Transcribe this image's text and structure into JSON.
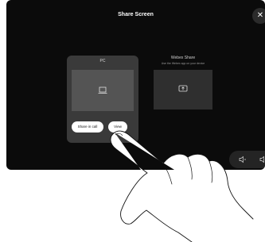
{
  "header": {
    "title": "Share Screen",
    "close_icon": "close-icon"
  },
  "pc": {
    "label": "PC",
    "preview_icon": "laptop-icon",
    "share_button": "Share in call",
    "view_button": "View"
  },
  "webex": {
    "title": "Webex Share",
    "subtitle": "Use the Webex app on your device",
    "preview_icon": "share-screen-icon"
  },
  "volume": {
    "down_icon": "volume-down-icon",
    "up_icon": "volume-up-icon"
  },
  "colors": {
    "screen_bg": "#0b0b0b",
    "card_bg": "#3a3a3a",
    "accent_white": "#ffffff"
  }
}
